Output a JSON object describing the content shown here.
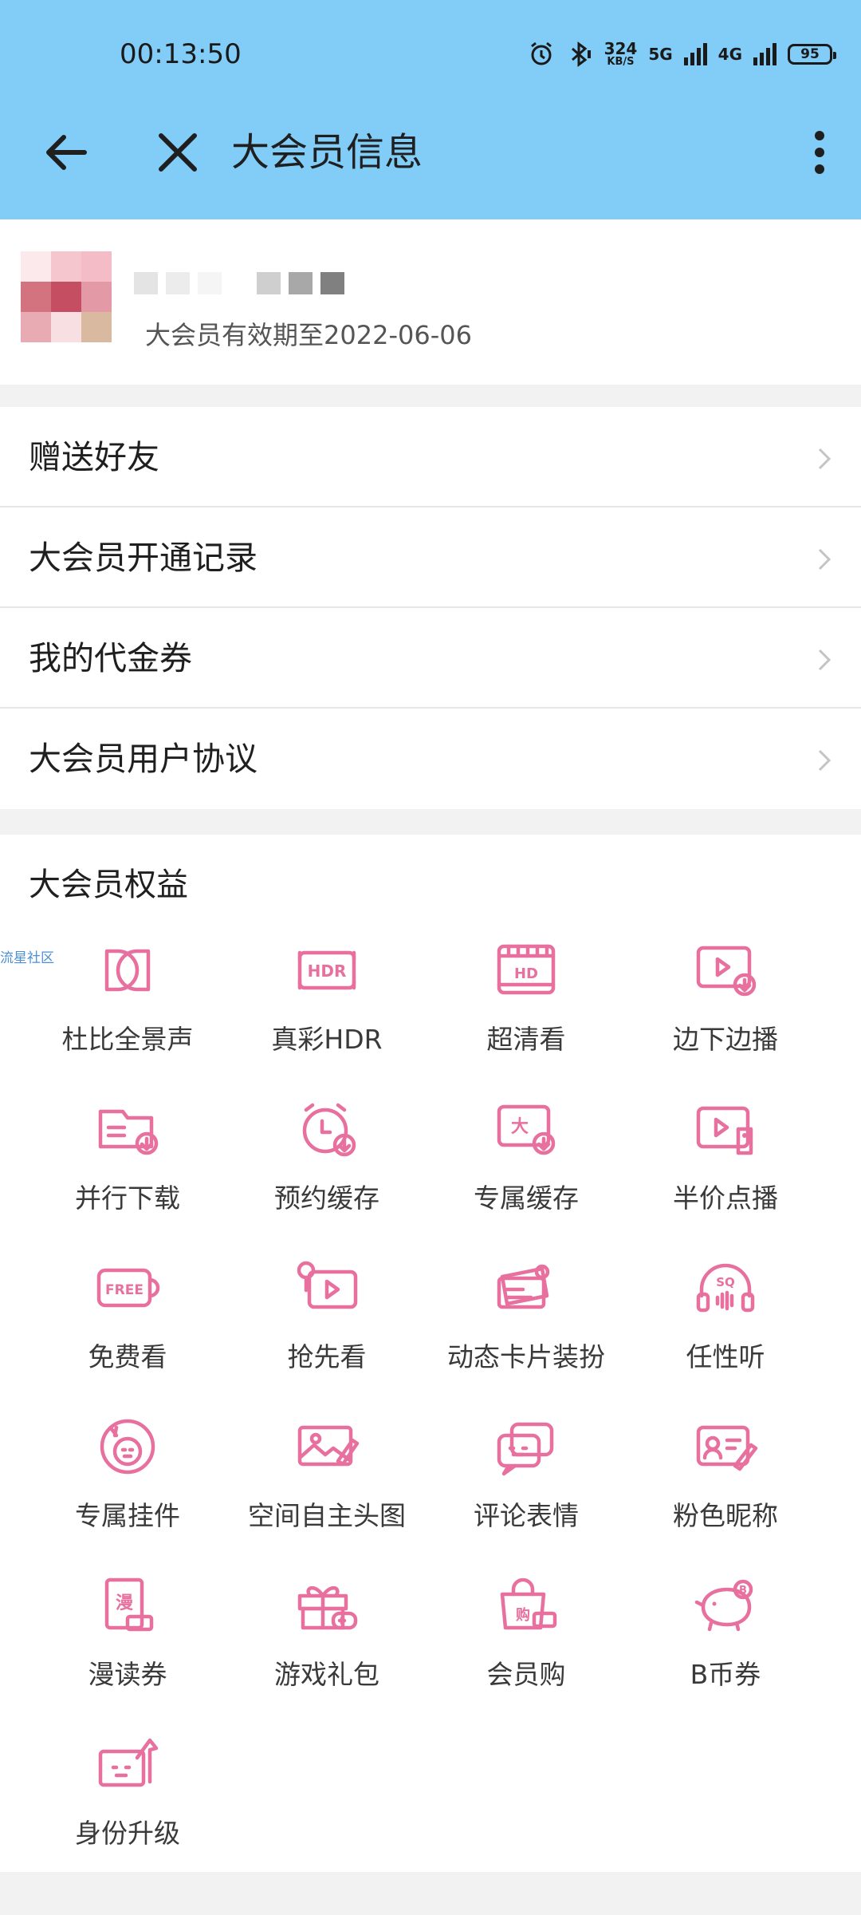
{
  "status_bar": {
    "time": "00:13:50",
    "net_speed_value": "324",
    "net_speed_unit": "KB/S",
    "signal_1": "5G",
    "signal_2": "4G",
    "battery": "95"
  },
  "header": {
    "title": "大会员信息"
  },
  "user": {
    "expire_text": "大会员有效期至2022-06-06"
  },
  "menu": [
    {
      "label": "赠送好友"
    },
    {
      "label": "大会员开通记录"
    },
    {
      "label": "我的代金券"
    },
    {
      "label": "大会员用户协议"
    }
  ],
  "benefits": {
    "title": "大会员权益",
    "watermark": "流星社区",
    "items": [
      {
        "label": "杜比全景声",
        "icon": "dolby-icon"
      },
      {
        "label": "真彩HDR",
        "icon": "hdr-icon"
      },
      {
        "label": "超清看",
        "icon": "hd-icon"
      },
      {
        "label": "边下边播",
        "icon": "download-play-icon"
      },
      {
        "label": "并行下载",
        "icon": "parallel-download-icon"
      },
      {
        "label": "预约缓存",
        "icon": "alarm-cache-icon"
      },
      {
        "label": "专属缓存",
        "icon": "exclusive-cache-icon"
      },
      {
        "label": "半价点播",
        "icon": "half-price-icon"
      },
      {
        "label": "免费看",
        "icon": "free-icon"
      },
      {
        "label": "抢先看",
        "icon": "early-watch-icon"
      },
      {
        "label": "动态卡片装扮",
        "icon": "card-decor-icon"
      },
      {
        "label": "任性听",
        "icon": "headphone-icon"
      },
      {
        "label": "专属挂件",
        "icon": "pendant-icon"
      },
      {
        "label": "空间自主头图",
        "icon": "space-banner-icon"
      },
      {
        "label": "评论表情",
        "icon": "comment-emoji-icon"
      },
      {
        "label": "粉色昵称",
        "icon": "pink-nickname-icon"
      },
      {
        "label": "漫读券",
        "icon": "comic-coupon-icon"
      },
      {
        "label": "游戏礼包",
        "icon": "game-gift-icon"
      },
      {
        "label": "会员购",
        "icon": "shopping-bag-icon"
      },
      {
        "label": "B币券",
        "icon": "piggy-bank-icon"
      },
      {
        "label": "身份升级",
        "icon": "level-up-icon"
      }
    ]
  },
  "colors": {
    "header_bg": "#81cdf8",
    "accent_pink": "#e8709f"
  }
}
